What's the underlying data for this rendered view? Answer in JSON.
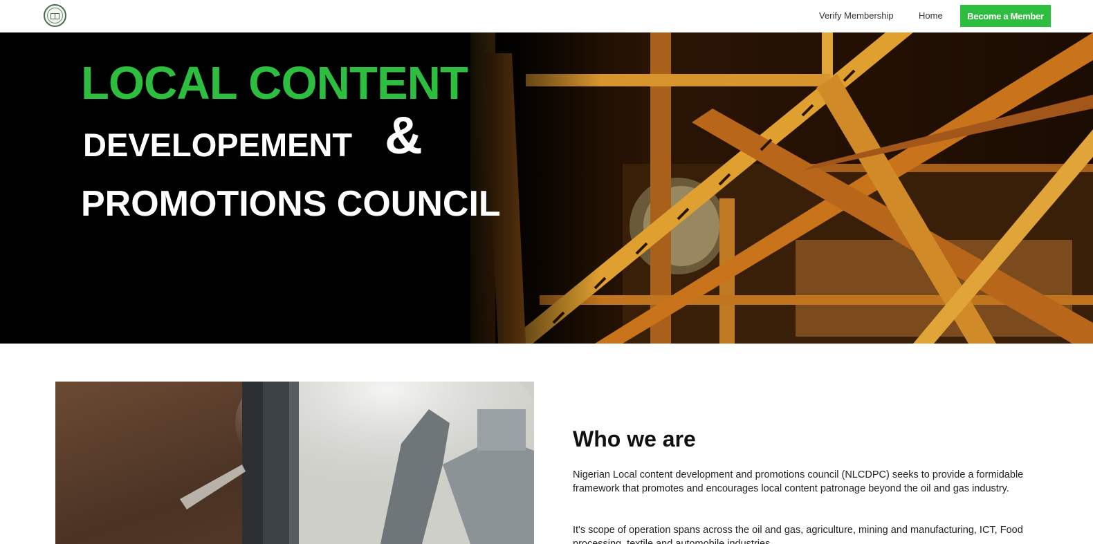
{
  "header": {
    "logo_icon": "council-seal-logo",
    "nav": {
      "verify_label": "Verify Membership",
      "home_label": "Home",
      "cta_label": "Become a Member"
    }
  },
  "hero": {
    "line1": "LOCAL CONTENT",
    "line2": "DEVELOPEMENT",
    "amp": "&",
    "line3": "PROMOTIONS COUNCIL",
    "background_image": "steel-oil-rig-structure-at-night"
  },
  "about": {
    "image": "drilling-machine-on-soil",
    "heading": "Who we are",
    "paragraph1": "Nigerian Local content development and promotions council (NLCDPC) seeks to provide a formidable framework that promotes and encourages local content patronage beyond the oil and gas industry.",
    "paragraph2": "It's scope of operation spans across the oil and gas, agriculture, mining and manufacturing, ICT, Food processing, textile and automobile industries."
  },
  "colors": {
    "brand_green": "#2dbd3f",
    "hero_black": "#000000",
    "steel_orange": "#c9741a"
  }
}
